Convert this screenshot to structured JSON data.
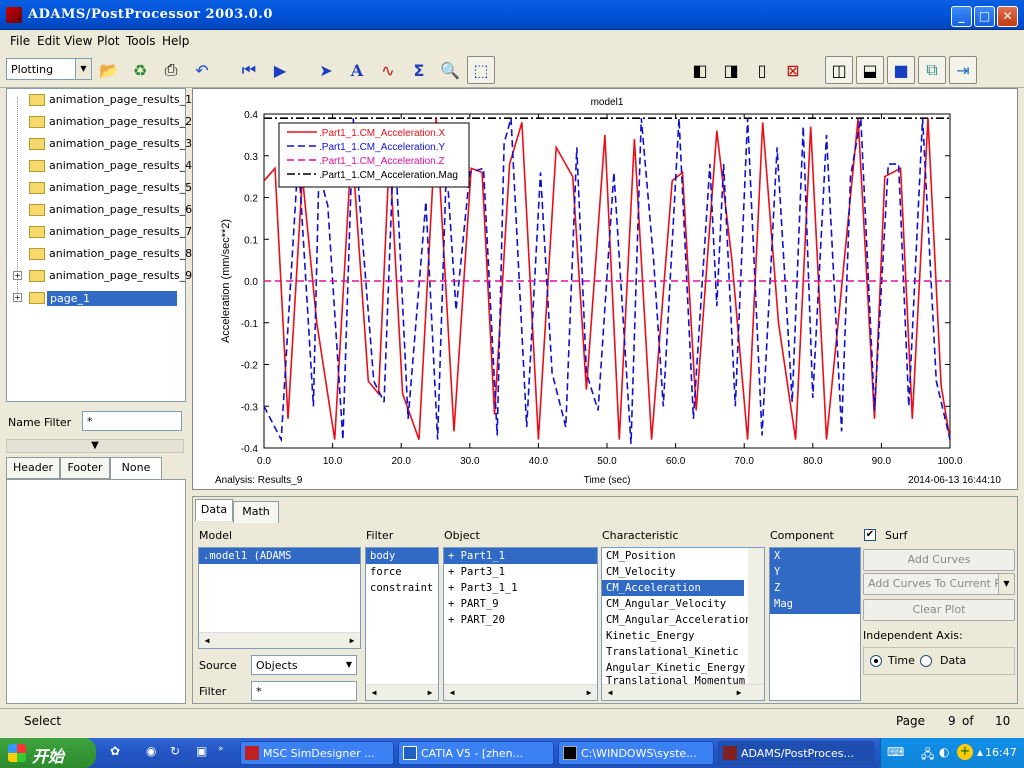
{
  "window": {
    "title": "ADAMS/PostProcessor 2003.0.0",
    "min": "_",
    "max": "□",
    "close": "✕"
  },
  "menu": [
    "File",
    "Edit",
    "View",
    "Plot",
    "Tools",
    "Help"
  ],
  "toolbar": {
    "mode": "Plotting"
  },
  "tree": {
    "items": [
      {
        "label": "animation_page_results_1",
        "expandable": false,
        "selected": false
      },
      {
        "label": "animation_page_results_2",
        "expandable": false,
        "selected": false
      },
      {
        "label": "animation_page_results_3",
        "expandable": false,
        "selected": false
      },
      {
        "label": "animation_page_results_4",
        "expandable": false,
        "selected": false
      },
      {
        "label": "animation_page_results_5",
        "expandable": false,
        "selected": false
      },
      {
        "label": "animation_page_results_6",
        "expandable": false,
        "selected": false
      },
      {
        "label": "animation_page_results_7",
        "expandable": false,
        "selected": false
      },
      {
        "label": "animation_page_results_8",
        "expandable": false,
        "selected": false
      },
      {
        "label": "animation_page_results_9",
        "expandable": true,
        "selected": false
      },
      {
        "label": "page_1",
        "expandable": true,
        "selected": true
      }
    ]
  },
  "name_filter": {
    "label": "Name Filter",
    "value": "*"
  },
  "left_tabs": [
    "Header",
    "Footer",
    "None"
  ],
  "chart_data": {
    "type": "line",
    "title": "model1",
    "xlabel": "Time (sec)",
    "ylabel": "Acceleration (mm/sec**2)",
    "xlim": [
      0.0,
      100.0
    ],
    "ylim": [
      -0.4,
      0.4
    ],
    "xticks": [
      "0.0",
      "10.0",
      "20.0",
      "30.0",
      "40.0",
      "50.0",
      "60.0",
      "70.0",
      "80.0",
      "90.0",
      "100.0"
    ],
    "yticks": [
      "0.4",
      "0.3",
      "0.2",
      "0.1",
      "0.0",
      "-0.1",
      "-0.2",
      "-0.3",
      "-0.4"
    ],
    "footer_left": "Analysis:  Results_9",
    "footer_right": "2014-06-13 16:44:10",
    "legend_position": "top-left",
    "series": [
      {
        "name": ".Part1_1.CM_Acceleration.X",
        "color": "#e8101a",
        "dash": "solid",
        "x": [
          0,
          1.6,
          3.5,
          5.6,
          7.7,
          10.3,
          12.8,
          15.2,
          16.7,
          18.3,
          20.2,
          22.6,
          25.1,
          27.7,
          30.2,
          31.8,
          33.6,
          35.8,
          37.6,
          40.0,
          42.6,
          45.0,
          47.0,
          49.7,
          51.8,
          54.0,
          56.5,
          59.5,
          61.0,
          63.0,
          66.0,
          68.2,
          70.5,
          72.7,
          75.0,
          77.5,
          79.7,
          82.0,
          84.0,
          86.6,
          89.0,
          90.5,
          92.8,
          94.5,
          96.8,
          98.7,
          100
        ],
        "y": [
          0.24,
          0.27,
          -0.33,
          0.25,
          -0.1,
          -0.38,
          0.33,
          -0.24,
          -0.27,
          0.31,
          -0.27,
          -0.38,
          0.39,
          -0.36,
          0.27,
          0.26,
          -0.32,
          0.28,
          0.38,
          -0.38,
          0.32,
          0.25,
          -0.26,
          0.35,
          -0.38,
          0.34,
          -0.38,
          0.24,
          0.26,
          -0.31,
          0.36,
          0.05,
          -0.38,
          0.38,
          -0.1,
          -0.38,
          0.37,
          -0.38,
          -0.05,
          0.39,
          -0.33,
          0.25,
          0.27,
          -0.33,
          0.39,
          -0.25,
          -0.38
        ]
      },
      {
        "name": ".Part1_1.CM_Acceleration.Y",
        "color": "#1010d0",
        "dash": "dashed",
        "x": [
          0,
          2.5,
          5.0,
          7.2,
          8.0,
          9.3,
          11.5,
          13.0,
          14.4,
          16.0,
          17.5,
          19.0,
          21.0,
          23.6,
          25.3,
          26.6,
          28.0,
          30.0,
          32.0,
          34.0,
          35.0,
          36.0,
          38.3,
          40.3,
          42.0,
          44.0,
          45.6,
          47.0,
          48.7,
          51.0,
          53.5,
          55.0,
          56.8,
          58.2,
          60.5,
          62.6,
          65.0,
          66.0,
          67.0,
          68.7,
          70.5,
          72.6,
          74.8,
          77.0,
          78.6,
          80.0,
          82.0,
          84.2,
          85.5,
          87.0,
          89.0,
          91.0,
          92.5,
          94.0,
          96.0,
          98.0,
          100
        ],
        "y": [
          -0.3,
          -0.38,
          0.3,
          -0.3,
          0.26,
          0.18,
          -0.38,
          0.39,
          0.09,
          -0.24,
          -0.29,
          0.36,
          -0.33,
          0.19,
          -0.38,
          0.28,
          -0.07,
          0.26,
          0.27,
          -0.37,
          0.33,
          0.39,
          -0.35,
          0.26,
          -0.22,
          -0.35,
          0.32,
          -0.22,
          -0.31,
          0.26,
          -0.39,
          0.39,
          0.05,
          -0.3,
          0.39,
          -0.33,
          0.28,
          -0.06,
          0.28,
          -0.3,
          0.39,
          -0.37,
          0.32,
          -0.29,
          0.37,
          -0.28,
          0.35,
          -0.36,
          0.25,
          0.39,
          -0.31,
          0.28,
          0.28,
          -0.3,
          0.39,
          -0.24,
          -0.38
        ]
      },
      {
        "name": ".Part1_1.CM_Acceleration.Z",
        "color": "#e0109a",
        "dash": "dashed",
        "x": [
          0,
          100
        ],
        "y": [
          0.0,
          0.0
        ]
      },
      {
        "name": ".Part1_1.CM_Acceleration.Mag",
        "color": "#000000",
        "dash": "dashdot",
        "x": [
          0,
          1,
          100
        ],
        "y": [
          0.39,
          0.39,
          0.39
        ]
      }
    ]
  },
  "lower_tabs": [
    "Data",
    "Math"
  ],
  "lower": {
    "model_label": "Model",
    "model_items": [
      ".model1                    (ADAMS"
    ],
    "filter_label": "Filter",
    "filter_items": [
      "body",
      "force",
      "constraint"
    ],
    "object_label": "Object",
    "object_items": [
      "+ Part1_1",
      "+ Part3_1",
      "+ Part3_1_1",
      "+ PART_9",
      "+ PART_20"
    ],
    "characteristic_label": "Characteristic",
    "characteristic_items": [
      "CM_Position",
      "CM_Velocity",
      "CM_Acceleration",
      "CM_Angular_Velocity",
      "CM_Angular_Acceleration",
      "Kinetic_Energy",
      "Translational_Kinetic",
      "Angular_Kinetic_Energy",
      "Translational_Momentum"
    ],
    "component_label": "Component",
    "component_items": [
      "X",
      "Y",
      "Z",
      "Mag"
    ],
    "surf_label": "Surf",
    "add_curves": "Add Curves",
    "add_curves_to_plot": "Add Curves To Current Plot",
    "clear_plot": "Clear Plot",
    "independent_axis_label": "Independent Axis:",
    "time_label": "Time",
    "data_label": "Data",
    "source_label": "Source",
    "source_value": "Objects",
    "filter_field_label": "Filter",
    "filter_value": "*"
  },
  "status": {
    "left": "Select",
    "page_label": "Page",
    "page_current": "9",
    "of_label": "of",
    "page_total": "10"
  },
  "taskbar": {
    "start": "开始",
    "tasks": [
      "MSC SimDesigner ...",
      "CATIA V5 - [zhen...",
      "C:\\WINDOWS\\syste...",
      "ADAMS/PostProces..."
    ],
    "clock": "16:47"
  }
}
